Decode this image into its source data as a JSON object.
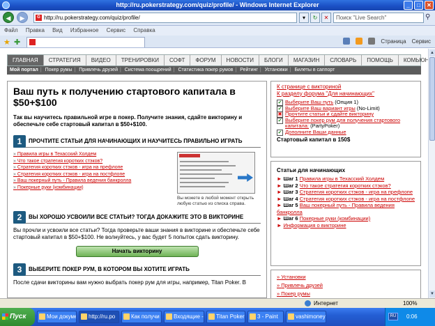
{
  "window": {
    "title": "http://ru.pokerstrategy.com/quiz/profile/ - Windows Internet Explorer",
    "url": "http://ru.pokerstrategy.com/quiz/profile/",
    "search_placeholder": "Поиск \"Live Search\""
  },
  "menu": [
    "Файл",
    "Правка",
    "Вид",
    "Избранное",
    "Сервис",
    "Справка"
  ],
  "toolbar": {
    "page": "Страница",
    "tools": "Сервис"
  },
  "site_nav": [
    "ГЛАВНАЯ",
    "СТРАТЕГИЯ",
    "ВИДЕО",
    "ТРЕНИРОВКИ",
    "СОФТ",
    "ФОРУМ",
    "НОВОСТИ",
    "БЛОГИ",
    "МАГАЗИН",
    "СЛОВАРЬ",
    "ПОМОЩЬ",
    "КОМЬЮНИТИ"
  ],
  "sub_nav": [
    "Мой портал",
    "Покер румы",
    "Привлечь друзей",
    "Система поощрений",
    "Статистика покер румов",
    "Рейтинг",
    "Установки",
    "Билеты в саппорт"
  ],
  "main": {
    "title": "Ваш путь к получению стартового капитала в $50+$100",
    "lead": "Так вы научитесь правильной игре в покер. Получите знания, сдайте викторину и обеспечьте себе стартовый капитал в $50+$100.",
    "step1": {
      "num": "1",
      "title": "ПРОЧТИТЕ СТАТЬИ ДЛЯ НАЧИНАЮЩИХ И НАУЧИТЕСЬ ПРАВИЛЬНО ИГРАТЬ",
      "links": [
        "Правила игры в Техасский Холдем",
        "Что такое стратегия коротких стэков?",
        "Стратегия коротких стэков - игра на префлопе",
        "Стратегия коротких стэков - игра на постфлопе",
        "Ваш покерный путь - Правила ведения банкролла",
        "Покерные руки (комбинации)"
      ],
      "caption": "Вы можете в любой момент открыть любую статью из списка справа."
    },
    "step2": {
      "num": "2",
      "title": "ВЫ ХОРОШО УСВОИЛИ ВСЕ СТАТЬИ? ТОГДА ДОКАЖИТЕ ЭТО В ВИКТОРИНЕ",
      "text": "Вы прочли и усвоили все статьи? Тогда проверьте ваши знания в викторине и обеспечьте себе стартовый капитал в $50+$100. Не волнуйтесь, у вас будет 5 попыток сдать викторину.",
      "button": "Начать викторину"
    },
    "step3": {
      "num": "3",
      "title": "ВЫБЕРИТЕ ПОКЕР РУМ, В КОТОРОМ ВЫ ХОТИТЕ ИГРАТЬ",
      "text": "После сдачи викторины вам нужно выбрать покер рум для игры, например, Titan Poker. В"
    }
  },
  "side1": {
    "links": [
      "К странице с викториной",
      "К разделу форума \"Для начинающих\""
    ],
    "checks": [
      {
        "state": "ok",
        "label": "Выберите Ваш путь",
        "extra": " (Опция 1)"
      },
      {
        "state": "ok",
        "label": "Выберите Ваш вариант игры",
        "extra": " (No-Limit)"
      },
      {
        "state": "no",
        "label": "Прочтите статьи и сдайте викторину",
        "extra": ""
      },
      {
        "state": "ok",
        "label": "Выберите покер рум для получения стартового капитала:",
        "extra": " (PartyPoker)"
      },
      {
        "state": "ok",
        "label": "Дополните Ваши данные",
        "extra": ""
      }
    ],
    "capital": "Стартовый капитал в 150$"
  },
  "side2": {
    "title": "Статьи для начинающих",
    "items": [
      {
        "step": "Шаг 1",
        "text": "Правила игры в Техасский Холдем"
      },
      {
        "step": "Шаг 2",
        "text": "Что такое стратегия коротких стэков?"
      },
      {
        "step": "Шаг 3",
        "text": "Стратегия коротких стэков - игра на префлопе"
      },
      {
        "step": "Шаг 4",
        "text": "Стратегия коротких стэков - игра на постфлопе"
      },
      {
        "step": "Шаг 5",
        "text": "Ваш покерный путь - Правила ведения банкролла"
      },
      {
        "step": "Шаг 6",
        "text": "Покерные руки (комбинации)"
      },
      {
        "step": "",
        "text": "Информация о викторине"
      }
    ]
  },
  "side3": [
    "Установки",
    "Привлечь друзей",
    "Покер румы"
  ],
  "status": {
    "zone": "Интернет",
    "zoom": "100%"
  },
  "taskbar": {
    "start": "Пуск",
    "tasks": [
      "Мои докуме",
      "http://ru.po",
      "Как получи",
      "Входящие -",
      "Titan Poker",
      "3 - Paint",
      "vashimoney"
    ],
    "lang": "RU",
    "clock": "0:06"
  }
}
